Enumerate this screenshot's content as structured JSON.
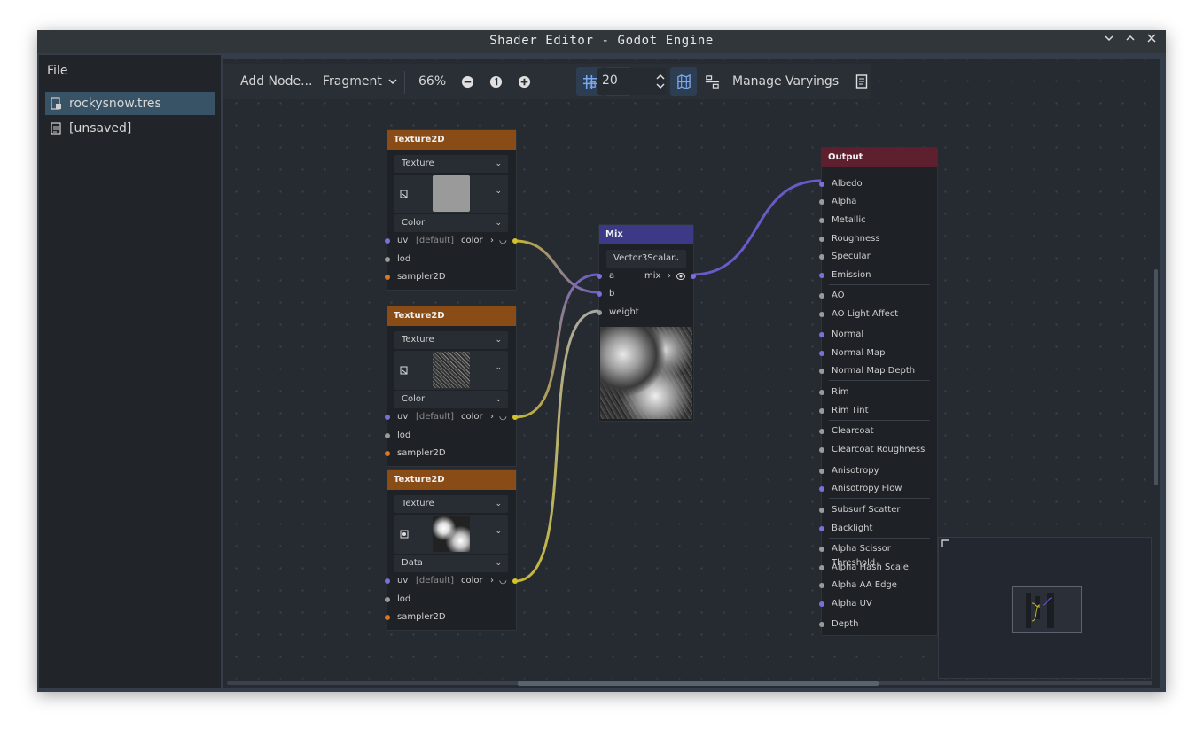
{
  "window": {
    "title": "Shader Editor - Godot Engine",
    "buttons": [
      "chevron-down-icon",
      "chevron-up-icon",
      "close-icon"
    ]
  },
  "sidebar": {
    "menu": "File",
    "files": [
      {
        "label": "rockysnow.tres",
        "selected": true,
        "icon": "shader-resource-icon"
      },
      {
        "label": "[unsaved]",
        "selected": false,
        "icon": "file-icon"
      }
    ]
  },
  "toolbar": {
    "add_node": "Add Node...",
    "mode": "Fragment",
    "zoom": "66%",
    "snap_distance": "20",
    "manage_varyings": "Manage Varyings"
  },
  "nodes": {
    "tex1": {
      "title": "Texture2D",
      "source": "Texture",
      "type": "Color",
      "preview": "flat-grey",
      "inputs": [
        "uv",
        "lod",
        "sampler2D"
      ],
      "uv_default": "[default]",
      "output": "color"
    },
    "tex2": {
      "title": "Texture2D",
      "source": "Texture",
      "type": "Color",
      "preview": "rocky-noise",
      "inputs": [
        "uv",
        "lod",
        "sampler2D"
      ],
      "uv_default": "[default]",
      "output": "color"
    },
    "tex3": {
      "title": "Texture2D",
      "source": "Texture",
      "type": "Data",
      "preview": "cloud-noise",
      "inputs": [
        "uv",
        "lod",
        "sampler2D"
      ],
      "uv_default": "[default]",
      "output": "color"
    },
    "mix": {
      "title": "Mix",
      "op_type": "Vector3Scalar",
      "inputs": [
        "a",
        "b",
        "weight"
      ],
      "output": "mix"
    },
    "output": {
      "title": "Output",
      "ports": [
        "Albedo",
        "Alpha",
        "Metallic",
        "Roughness",
        "Specular",
        "Emission",
        "AO",
        "AO Light Affect",
        "Normal",
        "Normal Map",
        "Normal Map Depth",
        "Rim",
        "Rim Tint",
        "Clearcoat",
        "Clearcoat Roughness",
        "Anisotropy",
        "Anisotropy Flow",
        "Subsurf Scatter",
        "Backlight",
        "Alpha Scissor Threshold",
        "Alpha Hash Scale",
        "Alpha AA Edge",
        "Alpha UV",
        "Depth"
      ]
    }
  },
  "colors": {
    "accent": "#395366",
    "texture_header": "#8a4c16",
    "mix_header": "#3c3a86",
    "output_header": "#5e1f2e",
    "wire_vec3": "#6a5ac8",
    "wire_color": "#c8b830"
  }
}
